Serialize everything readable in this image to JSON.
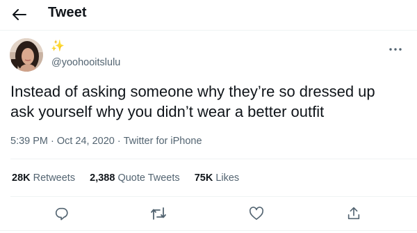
{
  "header": {
    "back_icon": "arrow-left-icon",
    "title": "Tweet"
  },
  "tweet": {
    "display_name": "✨",
    "handle": "@yoohooitslulu",
    "more_icon": "more-horizontal-icon",
    "text_line1": "Instead of asking someone why they’re so dressed up",
    "text_line2": "ask yourself why you didn’t wear a better outfit",
    "time": "5:39 PM",
    "separator": "·",
    "date": "Oct 24, 2020",
    "source": "Twitter for iPhone"
  },
  "stats": {
    "retweets_count": "28K",
    "retweets_label": "Retweets",
    "quotes_count": "2,388",
    "quotes_label": "Quote Tweets",
    "likes_count": "75K",
    "likes_label": "Likes"
  },
  "actions": {
    "icons": [
      "reply-icon",
      "retweet-icon",
      "like-icon",
      "share-icon"
    ]
  },
  "colors": {
    "text_primary": "#0f1419",
    "text_secondary": "#536471",
    "divider": "#eff3f4",
    "icon": "#536471"
  }
}
